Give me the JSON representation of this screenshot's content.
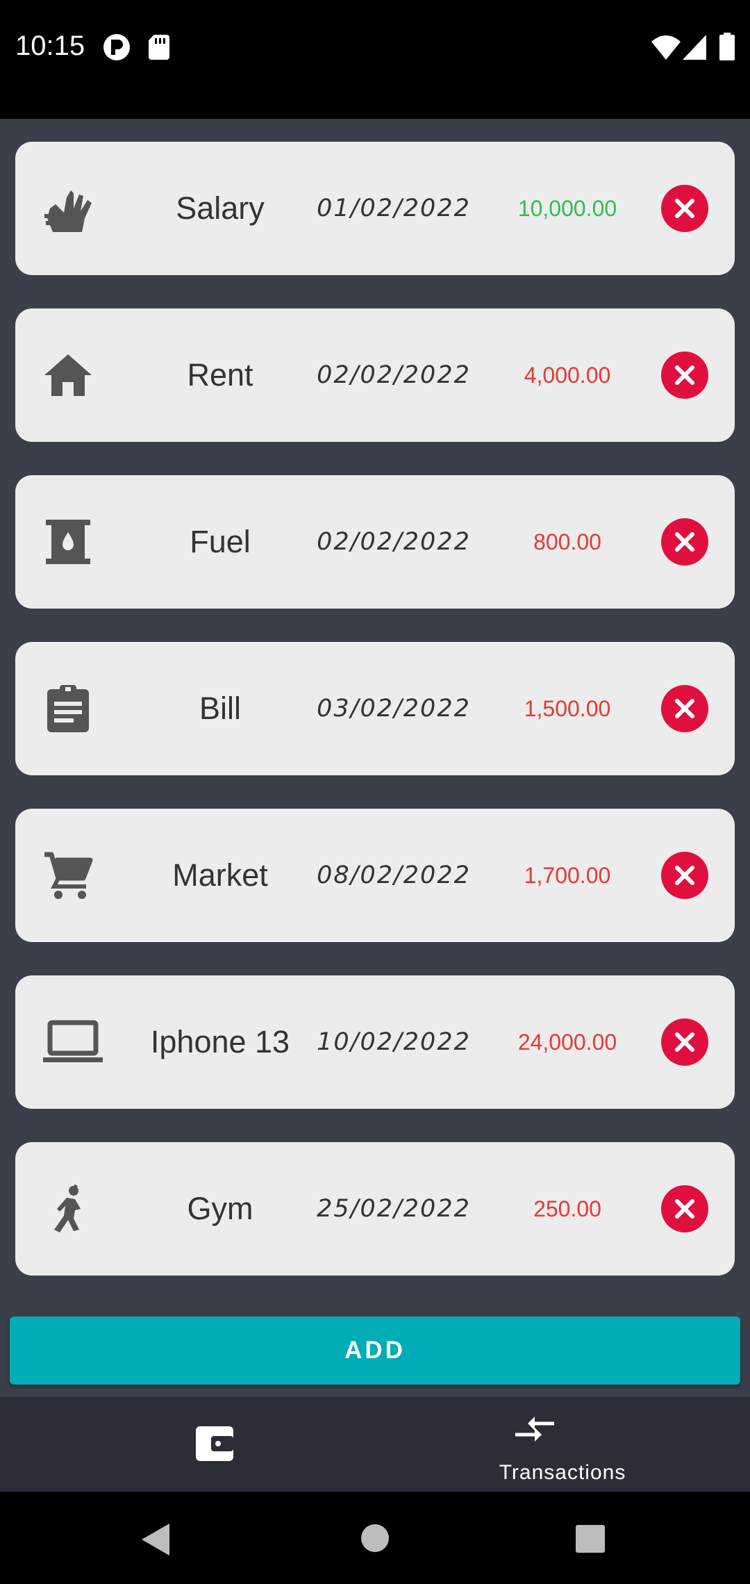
{
  "status_bar": {
    "time": "10:15",
    "icons": [
      "app-notification-icon",
      "sd-card-icon",
      "wifi-icon",
      "signal-icon",
      "battery-icon"
    ]
  },
  "transactions": [
    {
      "category": "Salary",
      "icon": "salary-hand-icon",
      "date": "01/02/2022",
      "amount": "10,000.00",
      "type": "income"
    },
    {
      "category": "Rent",
      "icon": "house-icon",
      "date": "02/02/2022",
      "amount": "4,000.00",
      "type": "expense"
    },
    {
      "category": "Fuel",
      "icon": "fuel-icon",
      "date": "02/02/2022",
      "amount": "800.00",
      "type": "expense"
    },
    {
      "category": "Bill",
      "icon": "clipboard-icon",
      "date": "03/02/2022",
      "amount": "1,500.00",
      "type": "expense"
    },
    {
      "category": "Market",
      "icon": "cart-icon",
      "date": "08/02/2022",
      "amount": "1,700.00",
      "type": "expense"
    },
    {
      "category": "Iphone 13",
      "icon": "laptop-icon",
      "date": "10/02/2022",
      "amount": "24,000.00",
      "type": "expense"
    },
    {
      "category": "Gym",
      "icon": "gym-icon",
      "date": "25/02/2022",
      "amount": "250.00",
      "type": "expense"
    }
  ],
  "add_button_label": "ADD",
  "bottom_nav": {
    "wallet_icon": "wallet-icon",
    "transactions_icon": "transactions-arrows-icon",
    "transactions_label": "Transactions"
  },
  "colors": {
    "income": "#2fbf4a",
    "expense": "#e53935",
    "delete": "#e0103e",
    "accent": "#00acb5",
    "background": "#3b3f49",
    "card": "#ececec"
  }
}
